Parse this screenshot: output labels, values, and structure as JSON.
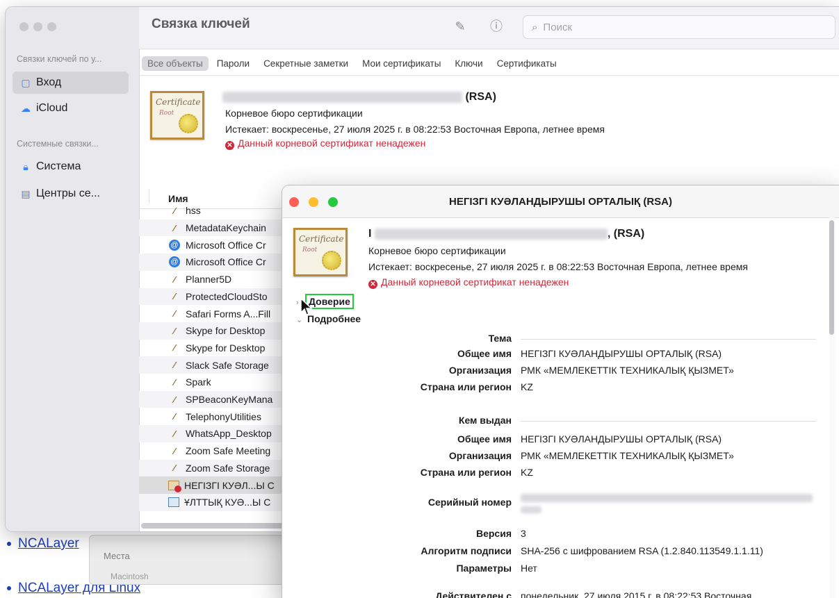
{
  "background": {
    "links": [
      "NCALayer",
      "NCALayer для Linux"
    ],
    "finder_section": "Места",
    "finder_item": "Macintosh"
  },
  "window": {
    "title": "Связка ключей",
    "search_placeholder": "Поиск"
  },
  "sidebar": {
    "section_user": "Связки ключей по у...",
    "user_items": [
      {
        "label": "Вход",
        "icon": "lock-open-icon",
        "selected": true
      },
      {
        "label": "iCloud",
        "icon": "cloud-icon",
        "selected": false
      }
    ],
    "section_system": "Системные связки...",
    "system_items": [
      {
        "label": "Система",
        "icon": "lock-icon"
      },
      {
        "label": "Центры се...",
        "icon": "cabinet-icon"
      }
    ]
  },
  "tabs": [
    "Все объекты",
    "Пароли",
    "Секретные заметки",
    "Мои сертификаты",
    "Ключи",
    "Сертификаты"
  ],
  "selected_cert": {
    "title_suffix": "(RSA)",
    "type": "Корневое бюро сертификации",
    "expires": "Истекает: воскресенье, 27 июля 2025 г. в 08:22:53 Восточная Европа, летнее время",
    "warning": "Данный корневой сертификат ненадежен",
    "icon_text": "Certificate",
    "icon_subtext": "Root"
  },
  "list": {
    "column_name": "Имя",
    "items": [
      {
        "name": "hss",
        "icon": "key-icon"
      },
      {
        "name": "MetadataKeychain",
        "icon": "key-icon"
      },
      {
        "name": "Microsoft Office Cr",
        "icon": "at-icon"
      },
      {
        "name": "Microsoft Office Cr",
        "icon": "at-icon"
      },
      {
        "name": "Planner5D",
        "icon": "key-icon"
      },
      {
        "name": "ProtectedCloudSto",
        "icon": "key-icon"
      },
      {
        "name": "Safari Forms A...Fill",
        "icon": "key-icon"
      },
      {
        "name": "Skype for Desktop",
        "icon": "key-icon"
      },
      {
        "name": "Skype for Desktop",
        "icon": "key-icon"
      },
      {
        "name": "Slack Safe Storage",
        "icon": "key-icon"
      },
      {
        "name": "Spark",
        "icon": "key-icon"
      },
      {
        "name": "SPBeaconKeyMana",
        "icon": "key-icon"
      },
      {
        "name": "TelephonyUtilities",
        "icon": "key-icon"
      },
      {
        "name": "WhatsApp_Desktop",
        "icon": "key-icon"
      },
      {
        "name": "Zoom Safe Meeting",
        "icon": "key-icon"
      },
      {
        "name": "Zoom Safe Storage",
        "icon": "key-icon"
      },
      {
        "name": "НЕГІЗГІ КУӘЛ...Ы С",
        "icon": "untrusted-cert-icon"
      },
      {
        "name": "ҰЛТТЫҚ КУӘ...Ы С",
        "icon": "cert-icon"
      }
    ]
  },
  "dialog": {
    "title": "НЕГІЗГІ КУӘЛАНДЫРУШЫ ОРТАЛЫҚ (RSA)",
    "header_prefix": "I",
    "header_suffix": ", (RSA)",
    "type": "Корневое бюро сертификации",
    "expires": "Истекает: воскресенье, 27 июля 2025 г. в 08:22:53 Восточная Европа, летнее время",
    "warning": "Данный корневой сертификат ненадежен",
    "disclosure_trust": "Доверие",
    "disclosure_details": "Подробнее",
    "subject_section": "Тема",
    "subject": [
      {
        "label": "Общее имя",
        "value": "НЕГІЗГІ КУӘЛАНДЫРУШЫ ОРТАЛЫҚ (RSA)"
      },
      {
        "label": "Организация",
        "value": "РМК «МЕМЛЕКЕТТІК ТЕХНИКАЛЫҚ ҚЫЗМЕТ»"
      },
      {
        "label": "Страна или регион",
        "value": "KZ"
      }
    ],
    "issuer_section": "Кем выдан",
    "issuer": [
      {
        "label": "Общее имя",
        "value": "НЕГІЗГІ КУӘЛАНДЫРУШЫ ОРТАЛЫҚ (RSA)"
      },
      {
        "label": "Организация",
        "value": "РМК «МЕМЛЕКЕТТІК ТЕХНИКАЛЫҚ ҚЫЗМЕТ»"
      },
      {
        "label": "Страна или регион",
        "value": "KZ"
      }
    ],
    "serial_label": "Серийный номер",
    "version_label": "Версия",
    "version_value": "3",
    "sig_label": "Алгоритм подписи",
    "sig_value": "SHA-256 с шифрованием RSA (1.2.840.113549.1.1.11)",
    "params_label": "Параметры",
    "params_value": "Нет",
    "valid_from_label": "Действителен с",
    "valid_from_value": "понедельник, 27 июля 2015 г. в 08:22:53 Восточная"
  },
  "colors": {
    "warning": "#d0283a",
    "focus_ring": "#1fce3a",
    "close": "#ff5f57",
    "minimize": "#febc2e",
    "zoom": "#28c840"
  }
}
